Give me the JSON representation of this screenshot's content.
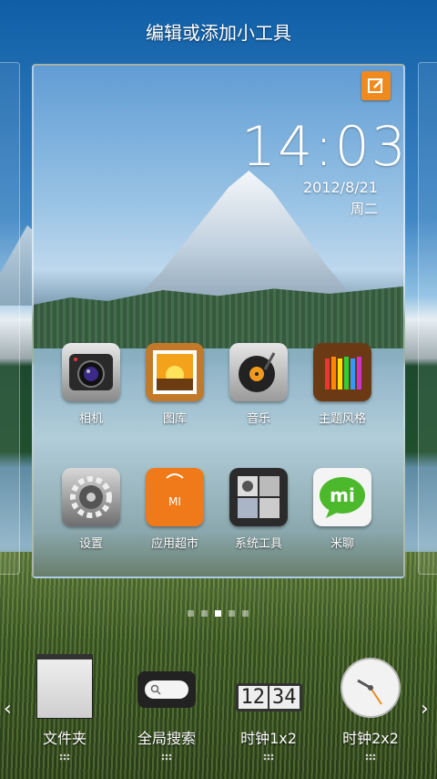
{
  "header": {
    "title": "编辑或添加小工具"
  },
  "preview": {
    "clock_time": "14:03",
    "date": "2012/8/21",
    "weekday": "周二",
    "apps": [
      {
        "label": "相机",
        "icon": "camera-icon"
      },
      {
        "label": "图库",
        "icon": "gallery-icon"
      },
      {
        "label": "音乐",
        "icon": "music-icon"
      },
      {
        "label": "主题风格",
        "icon": "themes-icon"
      },
      {
        "label": "设置",
        "icon": "settings-icon"
      },
      {
        "label": "应用超市",
        "icon": "app-market-icon"
      },
      {
        "label": "系统工具",
        "icon": "system-tools-icon"
      },
      {
        "label": "米聊",
        "icon": "miliao-icon",
        "badge": "mi"
      }
    ]
  },
  "pager": {
    "pages": 5,
    "active_index": 2
  },
  "widgets": [
    {
      "label": "文件夹",
      "icon": "folder-widget-icon"
    },
    {
      "label": "全局搜索",
      "icon": "search-widget-icon"
    },
    {
      "label": "时钟1x2",
      "icon": "clock-1x2-widget-icon",
      "digits": [
        "12",
        "34"
      ]
    },
    {
      "label": "时钟2x2",
      "icon": "clock-2x2-widget-icon"
    }
  ],
  "colors": {
    "accent": "#f08a1c"
  }
}
